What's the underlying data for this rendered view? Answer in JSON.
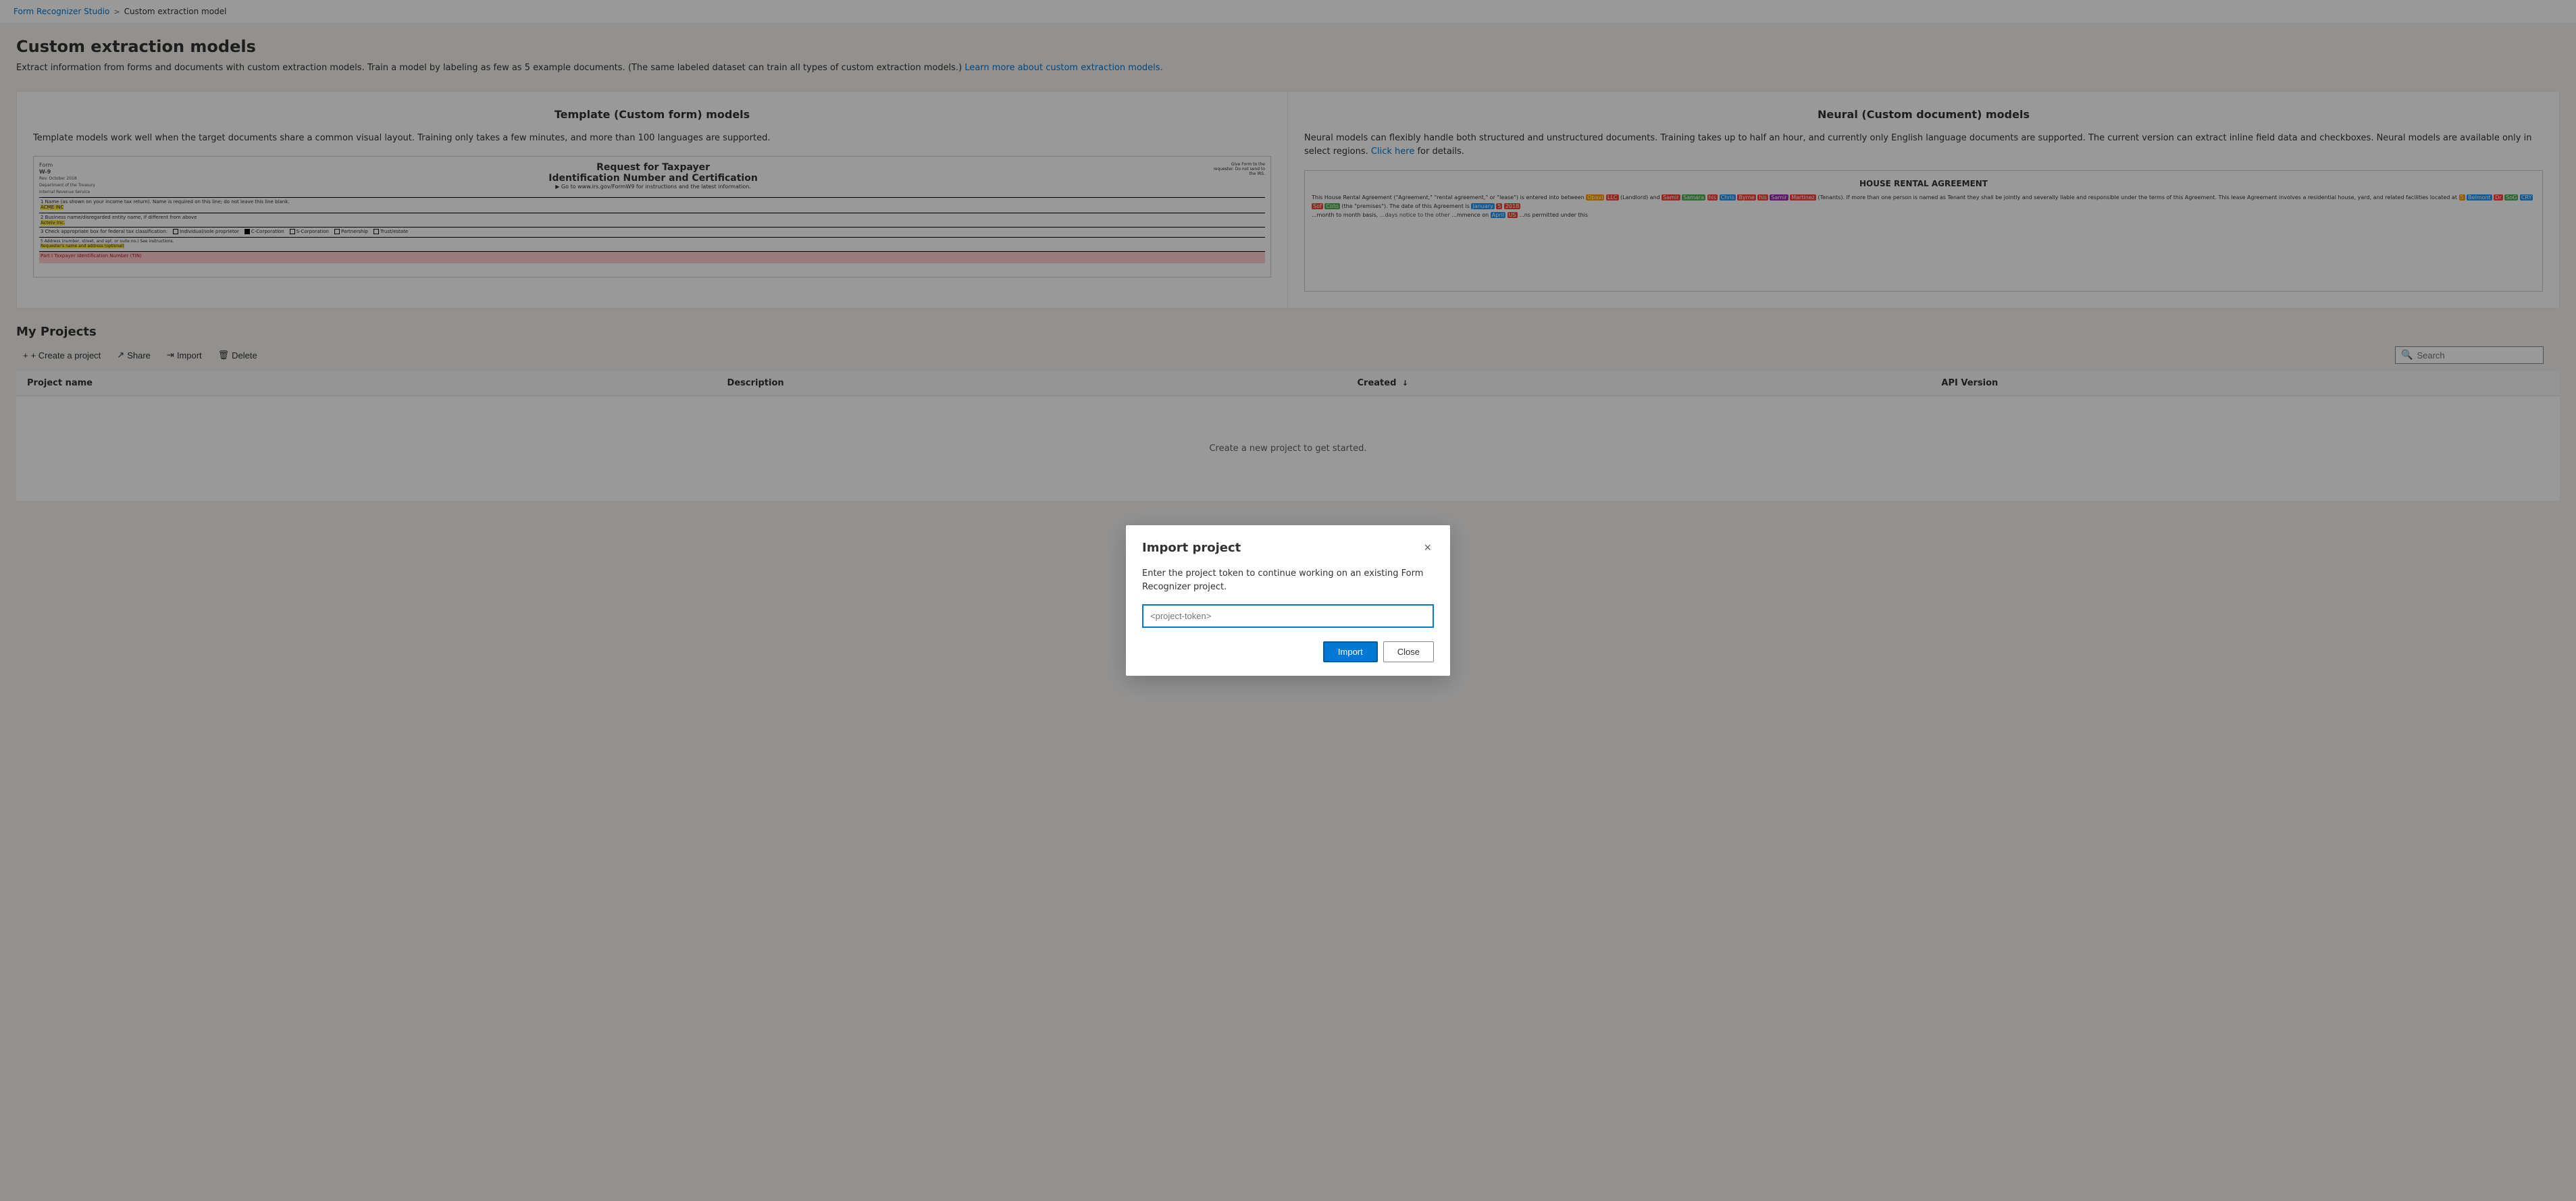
{
  "breadcrumb": {
    "home": "Form Recognizer Studio",
    "separator": ">",
    "current": "Custom extraction model"
  },
  "page": {
    "title": "Custom extraction models",
    "description": "Extract information from forms and documents with custom extraction models. Train a model by labeling as few as 5 example documents. (The same labeled dataset can train all types of custom extraction models.)",
    "learnMoreText": "Learn more about custom extraction models.",
    "learnMoreUrl": "#"
  },
  "templateCard": {
    "title": "Template (Custom form) models",
    "description": "Template models work well when the target documents share a common visual layout. Training only takes a few minutes, and more than 100 languages are supported."
  },
  "neuralCard": {
    "title": "Neural (Custom document) models",
    "description": "Neural models can flexibly handle both structured and unstructured documents. Training takes up to half an hour, and currently only English language documents are supported. The current version can extract inline field data and checkboxes. Neural models are available only in select regions.",
    "clickHereText": "Click here",
    "forDetailsText": "for details."
  },
  "myProjects": {
    "title": "My Projects",
    "toolbar": {
      "createLabel": "+ Create a project",
      "shareLabel": "Share",
      "importLabel": "Import",
      "deleteLabel": "Delete"
    },
    "table": {
      "columns": [
        "Project name",
        "Description",
        "Created ↓",
        "API Version"
      ],
      "emptyMessage": "Create a new project to get started."
    },
    "search": {
      "placeholder": "Search"
    }
  },
  "dialog": {
    "title": "Import project",
    "closeLabel": "×",
    "bodyText": "Enter the project token to continue working on an existing Form Recognizer project.",
    "inputPlaceholder": "<project-token>",
    "importButtonLabel": "Import",
    "closeButtonLabel": "Close"
  }
}
